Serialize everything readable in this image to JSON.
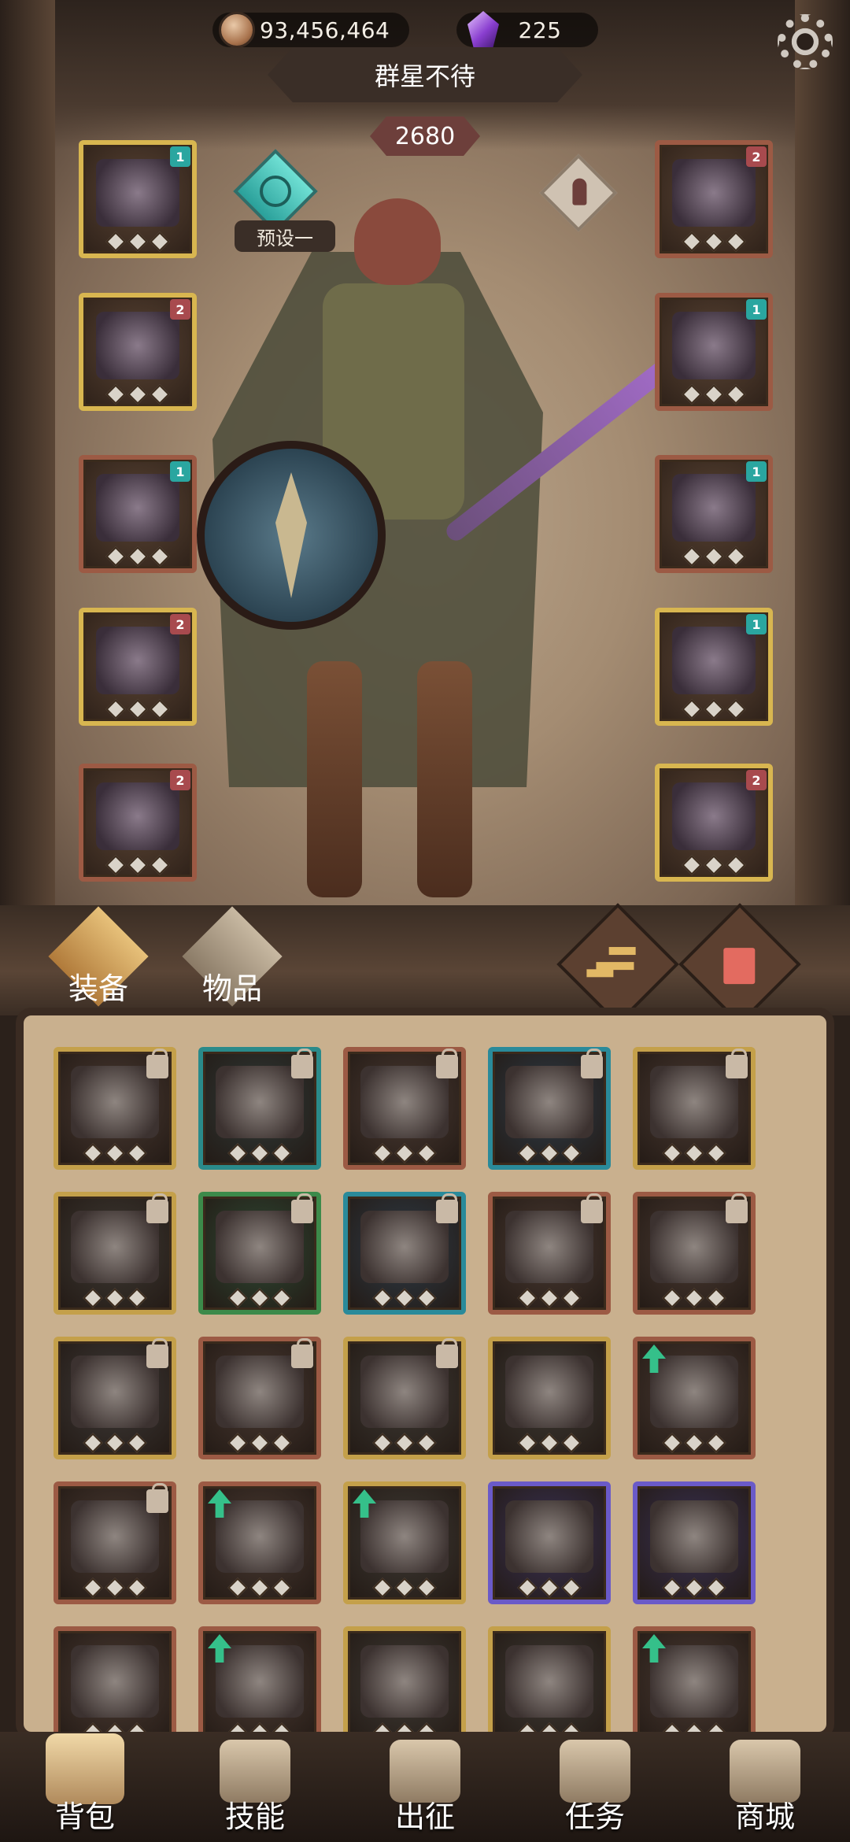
{
  "currencies": {
    "gold": "93,456,464",
    "gems": "225"
  },
  "header": {
    "title": "群星不待",
    "score": "2680",
    "preset_label": "预设一"
  },
  "equipment_slots": {
    "left": [
      {
        "item": "skull-helmet",
        "tag": "1",
        "tag_color": "#2aa6a0",
        "rarity": "gold"
      },
      {
        "item": "spiked-armor",
        "tag": "2",
        "tag_color": "#a84a4e",
        "rarity": "gold"
      },
      {
        "item": "bracer",
        "tag": "1",
        "tag_color": "#2aa6a0",
        "rarity": "red"
      },
      {
        "item": "belt-skirt",
        "tag": "2",
        "tag_color": "#a84a4e",
        "rarity": "gold"
      },
      {
        "item": "boots",
        "tag": "2",
        "tag_color": "#a84a4e",
        "rarity": "red"
      }
    ],
    "right": [
      {
        "item": "amulet",
        "tag": "2",
        "tag_color": "#a84a4e",
        "rarity": "red"
      },
      {
        "item": "ring",
        "tag": "1",
        "tag_color": "#2aa6a0",
        "rarity": "red"
      },
      {
        "item": "purple-gauntlet",
        "tag": "1",
        "tag_color": "#2aa6a0",
        "rarity": "red"
      },
      {
        "item": "flesh-sword",
        "tag": "1",
        "tag_color": "#2aa6a0",
        "rarity": "gold"
      },
      {
        "item": "horned-shield",
        "tag": "2",
        "tag_color": "#a84a4e",
        "rarity": "gold"
      }
    ]
  },
  "tabs": {
    "equipment": "装备",
    "items": "物品"
  },
  "inventory": [
    {
      "item": "claw-ring",
      "border": "#c4a04a",
      "bg": "#4a3a32",
      "marker": "lock"
    },
    {
      "item": "hood",
      "border": "#2a8a8a",
      "bg": "#2f3a38",
      "marker": "lock"
    },
    {
      "item": "star-buckler",
      "border": "#9c5a44",
      "bg": "#4a3a32",
      "marker": "lock"
    },
    {
      "item": "winged-helm",
      "border": "#2a8a9a",
      "bg": "#2e3c48",
      "marker": "lock"
    },
    {
      "item": "skull-pauldron",
      "border": "#c4a04a",
      "bg": "#4a3a32",
      "marker": "lock"
    },
    {
      "item": "plate-armor",
      "border": "#c4a04a",
      "bg": "#3e3a34",
      "marker": "lock"
    },
    {
      "item": "steel-boots",
      "border": "#3c8a4a",
      "bg": "#2e4a34",
      "marker": "lock"
    },
    {
      "item": "blue-robe",
      "border": "#2a8a9a",
      "bg": "#2e3c48",
      "marker": "lock"
    },
    {
      "item": "brown-robe",
      "border": "#9c5a44",
      "bg": "#4a3a32",
      "marker": "lock"
    },
    {
      "item": "leather-skirt",
      "border": "#9c5a44",
      "bg": "#4a3a32",
      "marker": "lock"
    },
    {
      "item": "round-shield",
      "border": "#c4a04a",
      "bg": "#3e3a38",
      "marker": "lock"
    },
    {
      "item": "blue-glove",
      "border": "#9c5a44",
      "bg": "#4a3a32",
      "marker": "lock"
    },
    {
      "item": "dark-skirt",
      "border": "#c4a04a",
      "bg": "#3e3a34",
      "marker": "lock"
    },
    {
      "item": "spike-crown",
      "border": "#c4a04a",
      "bg": "#3e3a34",
      "marker": "none"
    },
    {
      "item": "curved-blade",
      "border": "#9c5a44",
      "bg": "#4a3a32",
      "marker": "up-arrow"
    },
    {
      "item": "cross-shield",
      "border": "#9c5a44",
      "bg": "#4a3a32",
      "marker": "lock"
    },
    {
      "item": "dark-beret",
      "border": "#9c5a44",
      "bg": "#4a3a32",
      "marker": "up-arrow"
    },
    {
      "item": "serrated-sword",
      "border": "#c4a04a",
      "bg": "#3e3a34",
      "marker": "up-arrow"
    },
    {
      "item": "purple-gauntlet",
      "border": "#6a5ac8",
      "bg": "#3a3256",
      "marker": "none"
    },
    {
      "item": "ruby-ring",
      "border": "#6a5ac8",
      "bg": "#3a3256",
      "marker": "none"
    },
    {
      "item": "scarab-amulet",
      "border": "#9c5a44",
      "bg": "#4a3a32",
      "marker": "none"
    },
    {
      "item": "spiral-shield",
      "border": "#9c5a44",
      "bg": "#4a3a32",
      "marker": "up-arrow"
    },
    {
      "item": "iron-helm",
      "border": "#c4a04a",
      "bg": "#3e3a34",
      "marker": "none"
    },
    {
      "item": "serpent-ring",
      "border": "#c4a04a",
      "bg": "#3e3a34",
      "marker": "none"
    },
    {
      "item": "cosmic-cape",
      "border": "#9c5a44",
      "bg": "#4a3a32",
      "marker": "up-arrow"
    }
  ],
  "nav": {
    "backpack": "背包",
    "skills": "技能",
    "expedition": "出征",
    "quests": "任务",
    "shop": "商城"
  }
}
